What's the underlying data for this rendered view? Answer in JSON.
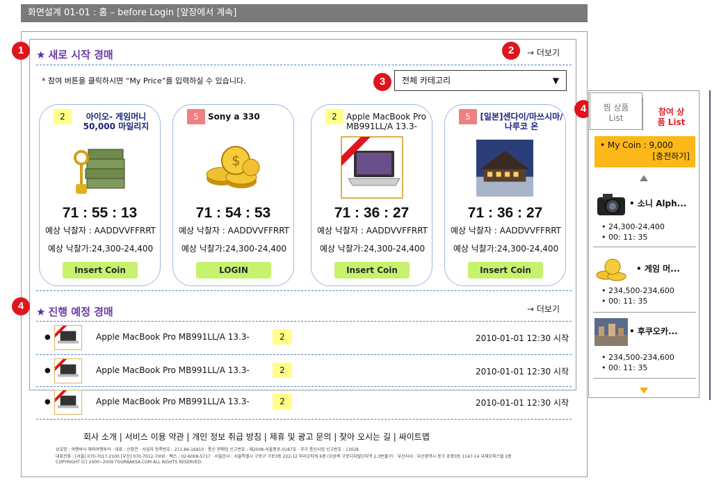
{
  "header": {
    "title": "화면설계 01-01 : 홈 – before Login [앞장에서 계속]"
  },
  "badges": {
    "b1": "1",
    "b2": "2",
    "b3": "3",
    "b4a": "4",
    "b4b": "4"
  },
  "new_auctions": {
    "title": "새로 시작 경매",
    "more": "→ 더보기",
    "note": "* 참여 버튼을 클릭하시면 “My Price”를 입력하실 수 있습니다.",
    "category": {
      "selected": "전체 카테고리",
      "arrow": "▼"
    },
    "items": [
      {
        "count": "2",
        "name": "아이오- 게임머니 50,000 마일리지",
        "timer": "71 : 55 : 13",
        "bidder": "예상 낙찰자 : AADDVVFFRRT",
        "price": "예상 낙찰가:24,300-24,400",
        "button": "Insert Coin",
        "icon": "money-key-icon"
      },
      {
        "count": "5",
        "name": "Sony a 330",
        "timer": "71 : 54 : 53",
        "bidder": "예상 낙찰자 : AADDVVFFRRT",
        "price": "예상 낙찰가:24,300-24,400",
        "button": "LOGIN",
        "icon": "gold-coins-icon"
      },
      {
        "count": "2",
        "name": "Apple MacBook Pro MB991LL/A 13.3-",
        "timer": "71 : 36 : 27",
        "bidder": "예상 낙찰자 : AADDVVFFRRT",
        "price": "예상 낙찰가:24,300-24,400",
        "button": "Insert Coin",
        "icon": "laptop-icon"
      },
      {
        "count": "5",
        "name": "[일본]센다이/마쓰시마/나루코 온",
        "timer": "71 : 36 : 27",
        "bidder": "예상 낙찰자 : AADDVVFFRRT",
        "price": "예상 낙찰가:24,300-24,400",
        "button": "Insert Coin",
        "icon": "hotel-photo-icon"
      }
    ]
  },
  "upcoming": {
    "title": "진행 예정 경매",
    "more": "→ 더보기",
    "rows": [
      {
        "name": "Apple MacBook Pro MB991LL/A 13.3-",
        "count": "2",
        "date": "2010-01-01 12:30 시작"
      },
      {
        "name": "Apple MacBook Pro MB991LL/A 13.3-",
        "count": "2",
        "date": "2010-01-01 12:30 시작"
      },
      {
        "name": "Apple MacBook Pro MB991LL/A 13.3-",
        "count": "2",
        "date": "2010-01-01 12:30 시작"
      }
    ]
  },
  "footer": {
    "links": "회사 소개 | 서비스 이용 약관 | 개인 정보 취급 방침 | 제휴 및 광고 문의 | 찾아 오시는 길 | 싸이트맵",
    "line1": "상호명 : 여행박사 해외여행투어 · 대표 : 신창연 · 사업자 등록번호 : 211-86-16810 · 통신 판매업 신고번호 : 제2008-서울종로-0187호 · 부가 통신사업 신고번호 : 13028",
    "line2": "대표전화 : [서울] 070-7017-2100 [부산] 070-7012-7000 · 팩스 : 02-6008-5717 · 서울본사 : 서울특별시 구로구 구로3동 222-12 마리오타워 6층 (오른쪽 구로디지털단지역 2,3번출구) · 부산지사 : 부산광역시 동구 초량3동 1147-14 국제오피스텔 2층",
    "line3": "COPYRIGHT (C) 2000~2009 TOURBAKSA.COM ALL RIGHTS RESERVED."
  },
  "sidebar": {
    "tab1": {
      "line1": "찜 상품",
      "line2": "List"
    },
    "tab2": {
      "line1": "참여 상",
      "line2": "품 List"
    },
    "coin": {
      "label": "• My Coin : 9,000",
      "charge": "[충전하기]"
    },
    "items": [
      {
        "name": "• 소니 Alph...",
        "price": "• 24,300-24,400",
        "time": "• 00: 11: 35",
        "icon": "camera-icon"
      },
      {
        "name": "• 게임 머...",
        "price": "• 234,500-234,600",
        "time": "• 00: 11: 35",
        "icon": "gold-coins-icon"
      },
      {
        "name": "• 후쿠오카...",
        "price": "• 234,500-234,600",
        "time": "• 00: 11: 35",
        "icon": "city-photo-icon"
      }
    ]
  },
  "colors": {
    "accent": "#6a3aa8",
    "badge": "#e0141c",
    "button": "#c6f26e",
    "coin_box": "#fbb818",
    "dash": "#4a7ec6"
  }
}
